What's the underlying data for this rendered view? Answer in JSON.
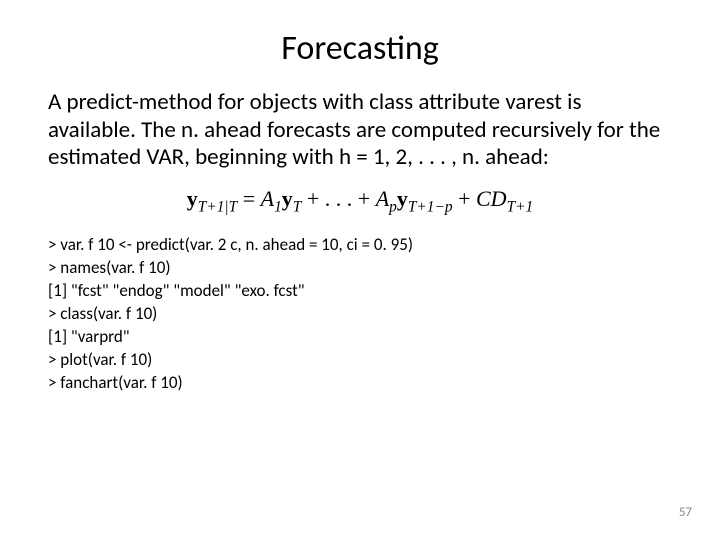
{
  "title": "Forecasting",
  "body": "A predict-method for objects with class attribute varest is available. The n. ahead forecasts are computed recursively for the estimated VAR, beginning with h = 1, 2, . . . , n. ahead:",
  "formula": {
    "lhs_y": "y",
    "lhs_sub": "T+1|T",
    "eq": " = ",
    "A1": "A",
    "A1_sub": "1",
    "y1": "y",
    "y1_sub": "T",
    "plus_dots": " + . . . + ",
    "Ap": "A",
    "Ap_sub": "p",
    "yp": "y",
    "yp_sub": "T+1−p",
    "plus": " + ",
    "CD": "CD",
    "CD_sub": "T+1"
  },
  "code": [
    "> var. f 10 <- predict(var. 2 c, n. ahead = 10, ci = 0. 95)",
    "> names(var. f 10)",
    "[1] \"fcst\" \"endog\" \"model\" \"exo. fcst\"",
    "> class(var. f 10)",
    "[1] \"varprd\"",
    "> plot(var. f 10)",
    "> fanchart(var. f 10)"
  ],
  "page_number": "57"
}
